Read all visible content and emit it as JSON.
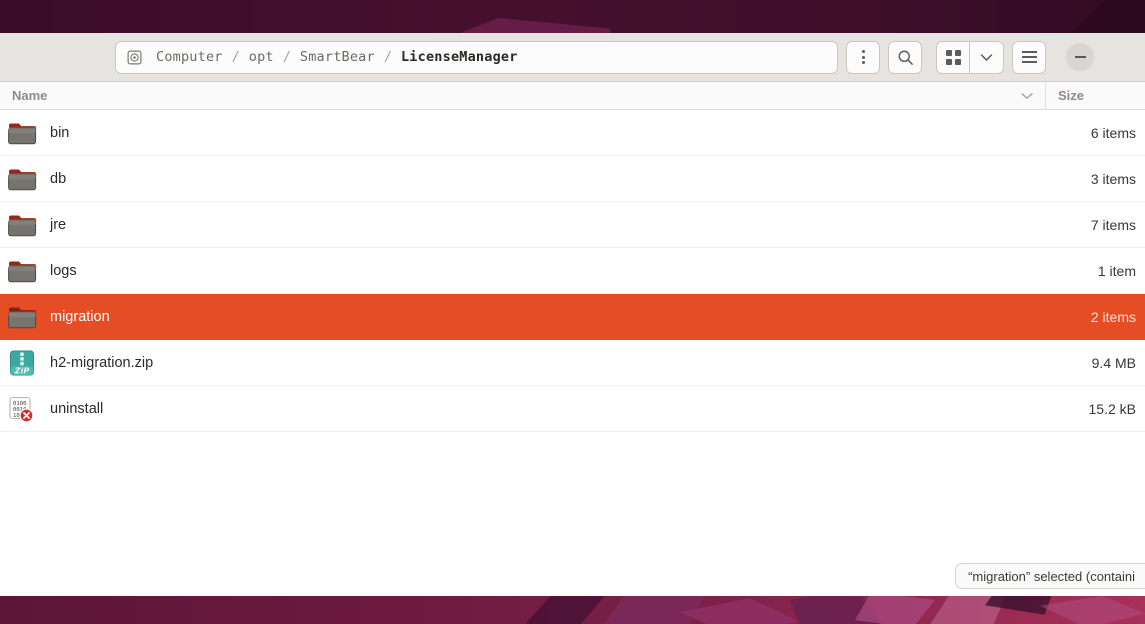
{
  "window": {
    "pathbar": {
      "leading_icon": "disk-icon",
      "crumbs": [
        {
          "label": "Computer",
          "current": false
        },
        {
          "label": "opt",
          "current": false
        },
        {
          "label": "SmartBear",
          "current": false
        },
        {
          "label": "LicenseManager",
          "current": true
        }
      ],
      "separator": "/"
    },
    "header_buttons": [
      {
        "name": "menu-button",
        "icon": "three-dots-icon"
      },
      {
        "name": "search-button",
        "icon": "search-icon"
      },
      {
        "name": "view-grid-button",
        "icon": "grid-view-icon"
      },
      {
        "name": "view-dropdown-button",
        "icon": "chevron-down-icon"
      },
      {
        "name": "main-menu-button",
        "icon": "hamburger-icon"
      },
      {
        "name": "minimize-button",
        "icon": "minimize-icon"
      }
    ]
  },
  "columns": {
    "name": "Name",
    "size": "Size",
    "sort_indicator": "chevron-down-icon"
  },
  "files": [
    {
      "name": "bin",
      "size": "6 items",
      "type": "folder",
      "selected": false
    },
    {
      "name": "db",
      "size": "3 items",
      "type": "folder",
      "selected": false
    },
    {
      "name": "jre",
      "size": "7 items",
      "type": "folder",
      "selected": false
    },
    {
      "name": "logs",
      "size": "1 item",
      "type": "folder",
      "selected": false
    },
    {
      "name": "migration",
      "size": "2 items",
      "type": "folder",
      "selected": true
    },
    {
      "name": "h2-migration.zip",
      "size": "9.4 MB",
      "type": "archive",
      "selected": false
    },
    {
      "name": "uninstall",
      "size": "15.2 kB",
      "type": "binary",
      "selected": false
    }
  ],
  "status": {
    "text": "“migration” selected  (containi"
  },
  "colors": {
    "selection": "#e54e24",
    "headerbar": "#e6e4e1",
    "folder_body": "#77736f",
    "folder_tab": "#e8652a",
    "archive": "#3aa9a0",
    "error_badge": "#d92b2b",
    "wallpaper_dark": "#3a0c2a",
    "wallpaper_light": "#a83059"
  }
}
